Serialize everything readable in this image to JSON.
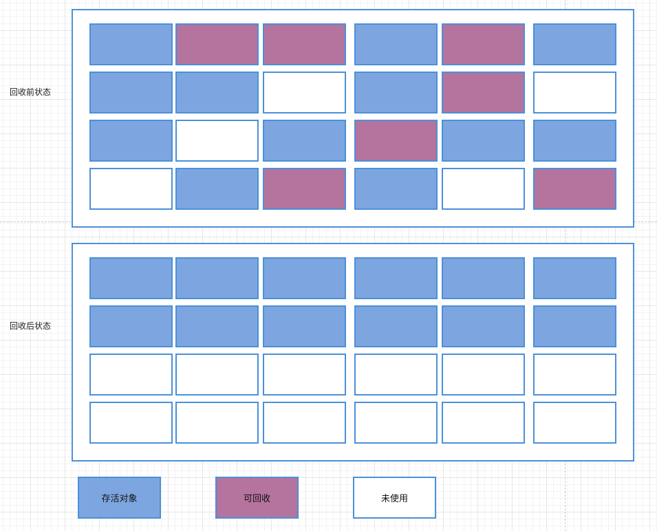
{
  "colors": {
    "alive": "#7da6e0",
    "reclaimable": "#b5749e",
    "unused": "#ffffff",
    "border": "#4a90d9"
  },
  "panels": [
    {
      "label": "回收前状态",
      "grid": [
        [
          "alive",
          "reclaimable",
          "reclaimable",
          "alive",
          "reclaimable",
          "alive"
        ],
        [
          "alive",
          "alive",
          "unused",
          "alive",
          "reclaimable",
          "unused"
        ],
        [
          "alive",
          "unused",
          "alive",
          "reclaimable",
          "alive",
          "alive"
        ],
        [
          "unused",
          "alive",
          "reclaimable",
          "alive",
          "unused",
          "reclaimable"
        ]
      ]
    },
    {
      "label": "回收后状态",
      "grid": [
        [
          "alive",
          "alive",
          "alive",
          "alive",
          "alive",
          "alive"
        ],
        [
          "alive",
          "alive",
          "alive",
          "alive",
          "alive",
          "alive"
        ],
        [
          "unused",
          "unused",
          "unused",
          "unused",
          "unused",
          "unused"
        ],
        [
          "unused",
          "unused",
          "unused",
          "unused",
          "unused",
          "unused"
        ]
      ]
    }
  ],
  "legend": [
    {
      "key": "alive",
      "label": "存活对象"
    },
    {
      "key": "reclaimable",
      "label": "可回收"
    },
    {
      "key": "unused",
      "label": "未使用"
    }
  ]
}
